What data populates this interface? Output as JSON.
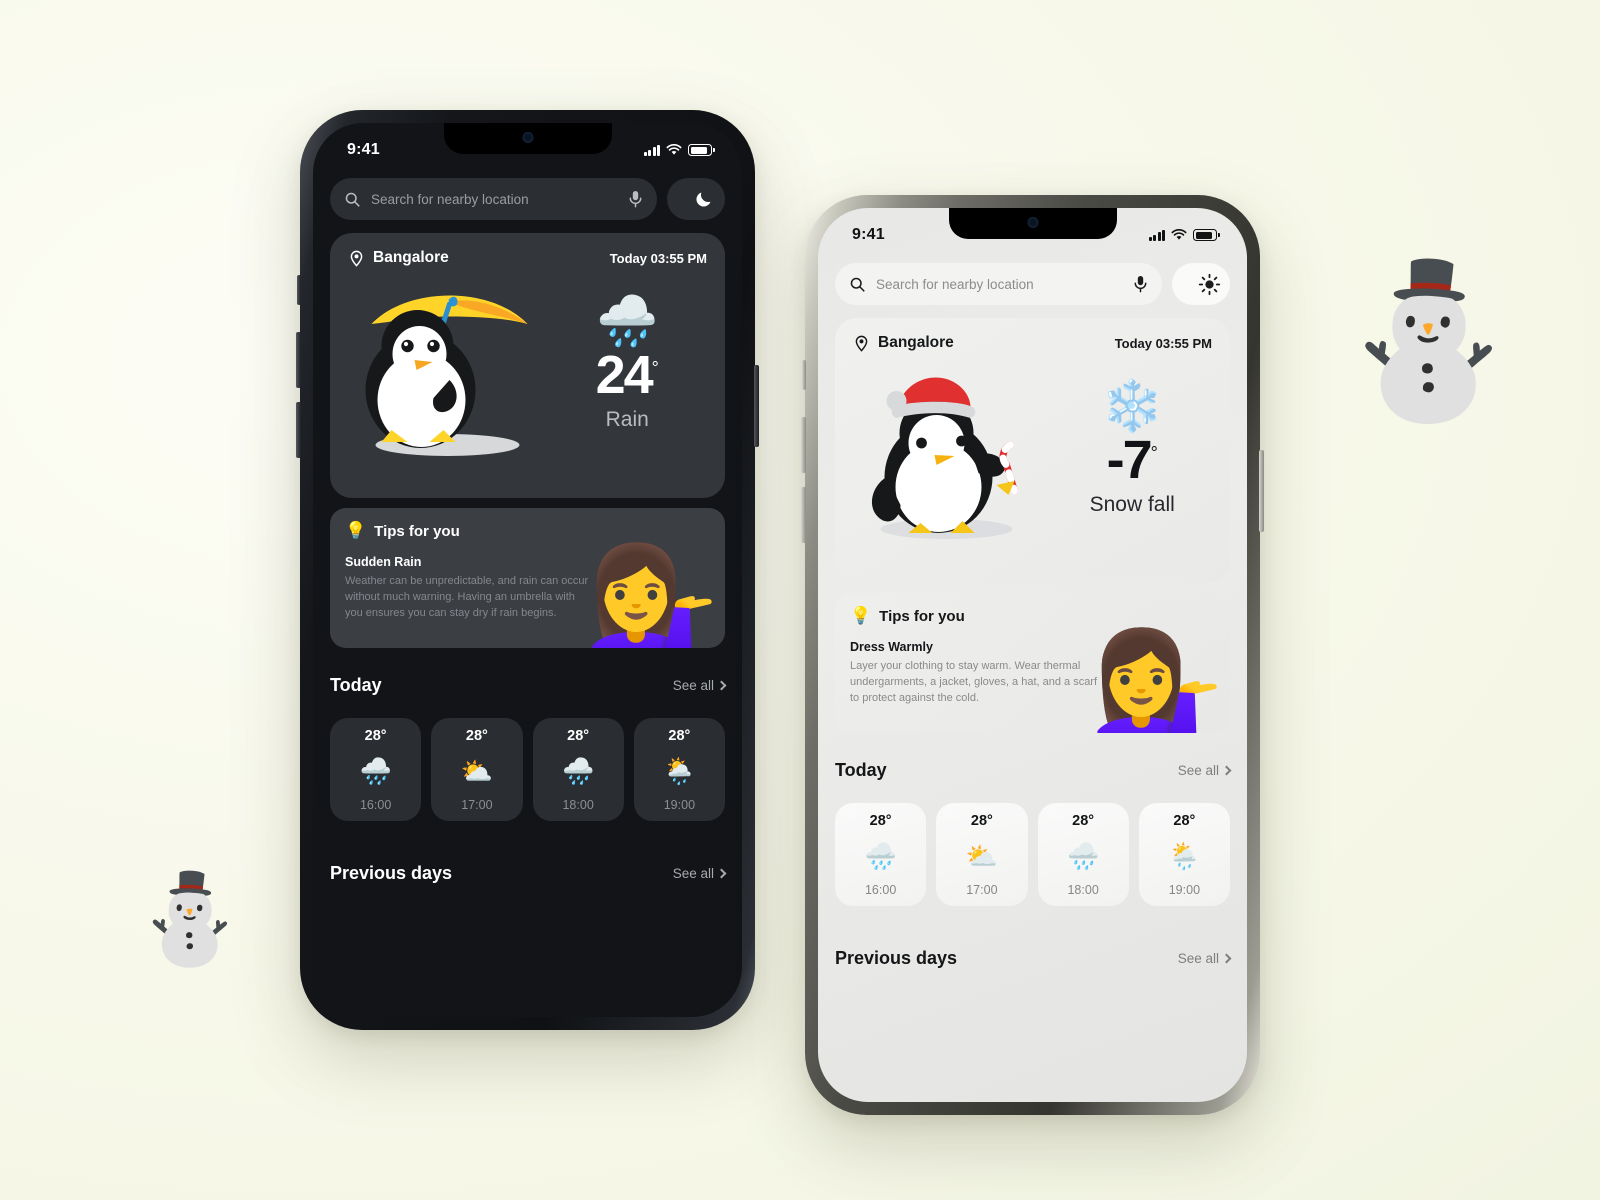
{
  "background": {
    "color": "#f5f6e8"
  },
  "decorations": {
    "snowman_left": {
      "icon": "snowman-emoji",
      "glyph": "⛄"
    },
    "snowman_right": {
      "icon": "snowman-emoji",
      "glyph": "⛄"
    }
  },
  "phones": [
    {
      "id": "dark",
      "theme": "dark",
      "status": {
        "time": "9:41",
        "signal_icon": "cellular-bars-icon",
        "wifi_icon": "wifi-icon",
        "battery_icon": "battery-icon"
      },
      "search": {
        "placeholder": "Search for nearby location",
        "search_icon": "search-icon",
        "mic_icon": "microphone-icon"
      },
      "theme_toggle": {
        "icon": "moon-icon",
        "glyph": "☾",
        "label": "Dark mode"
      },
      "weather_card": {
        "location_icon": "location-pin-icon",
        "location": "Bangalore",
        "time": "Today 03:55 PM",
        "illustration": "penguin-with-umbrella",
        "condition_icon": "rain-cloud-icon",
        "condition_glyph": "🌧️",
        "temperature": "24",
        "degree": "°",
        "condition": "Rain"
      },
      "tips": {
        "icon": "lightbulb-icon",
        "glyph": "💡",
        "title": "Tips for you",
        "subtitle": "Sudden Rain",
        "body": "Weather can be unpredictable, and rain can occur without much warning. Having an umbrella with you ensures you can stay dry if rain begins.",
        "character_icon": "woman-pointing-icon",
        "character_glyph": "💁‍♀️"
      },
      "today": {
        "title": "Today",
        "see_all": "See all",
        "chevron_icon": "chevron-right-icon",
        "hours": [
          {
            "temp": "28°",
            "icon": "rain-cloud-icon",
            "glyph": "🌧️",
            "time": "16:00"
          },
          {
            "temp": "28°",
            "icon": "sun-behind-cloud-icon",
            "glyph": "⛅",
            "time": "17:00"
          },
          {
            "temp": "28°",
            "icon": "rain-cloud-icon",
            "glyph": "🌧️",
            "time": "18:00"
          },
          {
            "temp": "28°",
            "icon": "sun-behind-rain-cloud-icon",
            "glyph": "🌦️",
            "time": "19:00"
          }
        ]
      },
      "previous_days": {
        "title": "Previous days",
        "see_all": "See all",
        "chevron_icon": "chevron-right-icon"
      }
    },
    {
      "id": "light",
      "theme": "light",
      "status": {
        "time": "9:41",
        "signal_icon": "cellular-bars-icon",
        "wifi_icon": "wifi-icon",
        "battery_icon": "battery-icon"
      },
      "search": {
        "placeholder": "Search for nearby location",
        "search_icon": "search-icon",
        "mic_icon": "microphone-icon"
      },
      "theme_toggle": {
        "icon": "sun-icon",
        "glyph": "☀",
        "label": "Light mode"
      },
      "weather_card": {
        "location_icon": "location-pin-icon",
        "location": "Bangalore",
        "time": "Today 03:55 PM",
        "illustration": "penguin-with-santa-hat",
        "condition_icon": "snowflake-icon",
        "condition_glyph": "❄️",
        "temperature": "-7",
        "degree": "°",
        "condition": "Snow fall"
      },
      "tips": {
        "icon": "lightbulb-icon",
        "glyph": "💡",
        "title": "Tips for you",
        "subtitle": "Dress Warmly",
        "body": "Layer your clothing to stay warm. Wear thermal undergarments, a jacket, gloves, a hat, and a scarf to protect against the cold.",
        "character_icon": "woman-pointing-icon",
        "character_glyph": "💁‍♀️"
      },
      "today": {
        "title": "Today",
        "see_all": "See all",
        "chevron_icon": "chevron-right-icon",
        "hours": [
          {
            "temp": "28°",
            "icon": "rain-cloud-icon",
            "glyph": "🌧️",
            "time": "16:00"
          },
          {
            "temp": "28°",
            "icon": "sun-behind-cloud-icon",
            "glyph": "⛅",
            "time": "17:00"
          },
          {
            "temp": "28°",
            "icon": "rain-cloud-icon",
            "glyph": "🌧️",
            "time": "18:00"
          },
          {
            "temp": "28°",
            "icon": "sun-behind-rain-cloud-icon",
            "glyph": "🌦️",
            "time": "19:00"
          }
        ]
      },
      "previous_days": {
        "title": "Previous days",
        "see_all": "See all",
        "chevron_icon": "chevron-right-icon"
      }
    }
  ]
}
